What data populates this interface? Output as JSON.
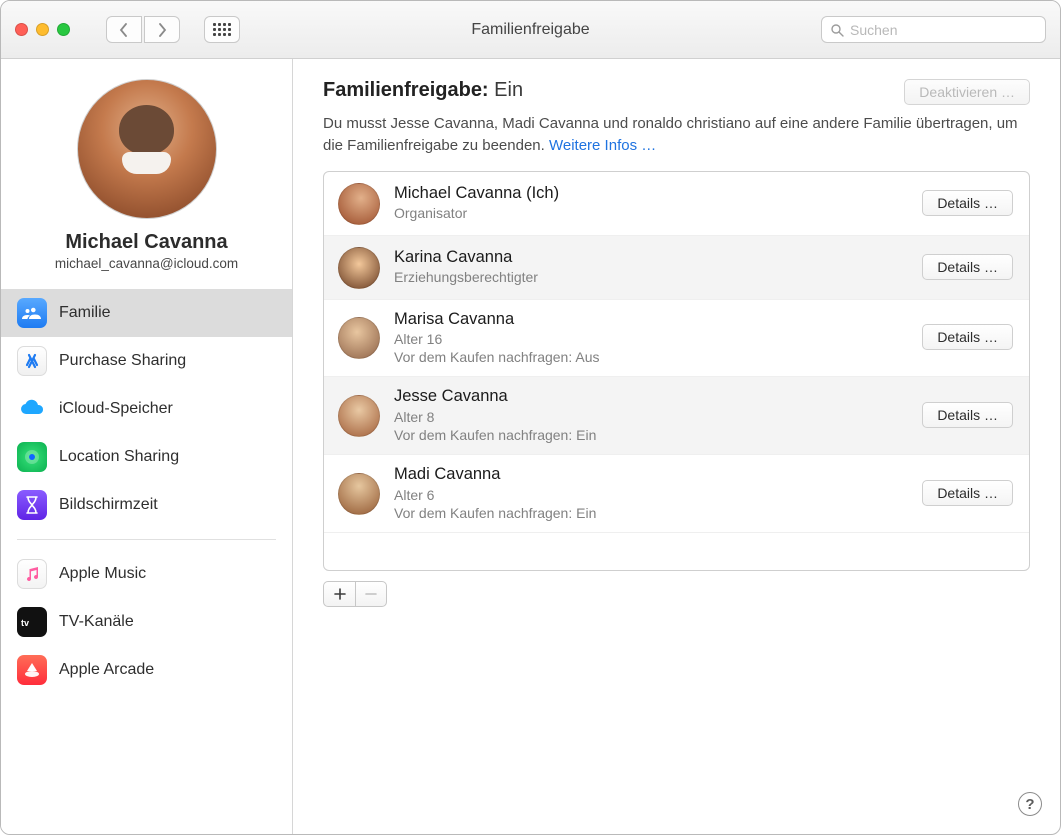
{
  "window": {
    "title": "Familienfreigabe"
  },
  "search": {
    "placeholder": "Suchen"
  },
  "sidebar": {
    "user_name": "Michael Cavanna",
    "user_email": "michael_cavanna@icloud.com",
    "items": [
      {
        "label": "Familie"
      },
      {
        "label": "Purchase Sharing"
      },
      {
        "label": "iCloud-Speicher"
      },
      {
        "label": "Location Sharing"
      },
      {
        "label": "Bildschirmzeit"
      }
    ],
    "items2": [
      {
        "label": "Apple Music"
      },
      {
        "label": "TV-Kanäle"
      },
      {
        "label": "Apple Arcade"
      }
    ]
  },
  "main": {
    "heading_label": "Familienfreigabe:",
    "heading_state": "Ein",
    "deactivate_label": "Deaktivieren …",
    "info_text": "Du musst Jesse Cavanna, Madi Cavanna und ronaldo christiano auf eine andere Familie übertragen, um die Familienfreigabe zu beenden. ",
    "info_link": "Weitere Infos …",
    "details_label": "Details …",
    "members": [
      {
        "name": "Michael Cavanna (Ich)",
        "sub": "Organisator",
        "sub2": ""
      },
      {
        "name": "Karina Cavanna",
        "sub": "Erziehungsberechtigter",
        "sub2": ""
      },
      {
        "name": "Marisa Cavanna",
        "sub": "Alter 16",
        "sub2": "Vor dem Kaufen nachfragen: Aus"
      },
      {
        "name": "Jesse Cavanna",
        "sub": "Alter 8",
        "sub2": "Vor dem Kaufen nachfragen: Ein"
      },
      {
        "name": "Madi Cavanna",
        "sub": "Alter 6",
        "sub2": "Vor dem Kaufen nachfragen: Ein"
      }
    ]
  }
}
